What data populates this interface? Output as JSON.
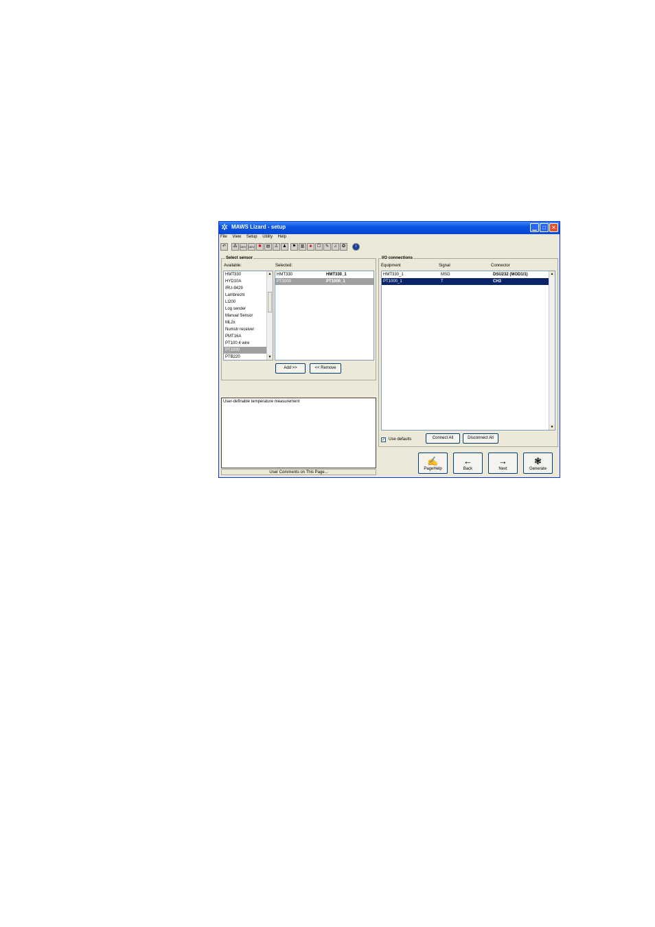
{
  "window": {
    "title": "MAWS Lizard - setup",
    "icon": "lizard-icon",
    "controls": [
      "minimize",
      "maximize",
      "close"
    ]
  },
  "menu": [
    "File",
    "View",
    "Setup",
    "Utility",
    "Help"
  ],
  "toolbar": {
    "icons": [
      "undo-icon",
      "network-icon",
      "dev-icon",
      "dev-icon",
      "sensor-icon",
      "logger-icon",
      "walk-icon",
      "person-icon",
      "flag-icon",
      "bars-icon",
      "bells-icon",
      "box-icon",
      "pen-icon",
      "bell-icon",
      "help-circle-icon",
      "info-icon"
    ],
    "labels": [
      "DEV",
      "DEV"
    ]
  },
  "select_sensor": {
    "title": "Select sensor",
    "available_label": "Available:",
    "selected_label": "Selected:",
    "available": [
      "HMT330",
      "HYD10A",
      "IRU-9429",
      "Lambrecht",
      "LI200",
      "Log sender",
      "Manual Sensor",
      "ML2x",
      "Numstr receiver",
      "PMT16A",
      "PT100 4 wire",
      "PT1000",
      "PTB220"
    ],
    "available_selected_index": 11,
    "selected": [
      {
        "type": "HMT330",
        "name": "HMT330_1"
      },
      {
        "type": "PT1000",
        "name": "PT1000_1"
      }
    ],
    "selected_selected_index": 1,
    "add_label": "Add >>",
    "remove_label": "<< Remove"
  },
  "comments": {
    "text": "User-definable temperature measurement",
    "footer": "User Comments on This Page..."
  },
  "io": {
    "title": "I/O connections",
    "headers": [
      "Equipment",
      "Signal",
      "Connector"
    ],
    "rows": [
      {
        "equipment": "HMT330_1",
        "signal": "MSG",
        "connector": "DSU232 (MOD1/1)"
      },
      {
        "equipment": "PT1000_1",
        "signal": "T",
        "connector": "CH3"
      }
    ],
    "highlight_index": 1,
    "use_defaults_label": "Use defaults",
    "use_defaults_checked": true,
    "connect_all_label": "Connect All",
    "disconnect_all_label": "Disconnect All"
  },
  "nav": {
    "pagehelp": "PageHelp",
    "back": "Back",
    "next": "Next",
    "generate": "Generate"
  }
}
